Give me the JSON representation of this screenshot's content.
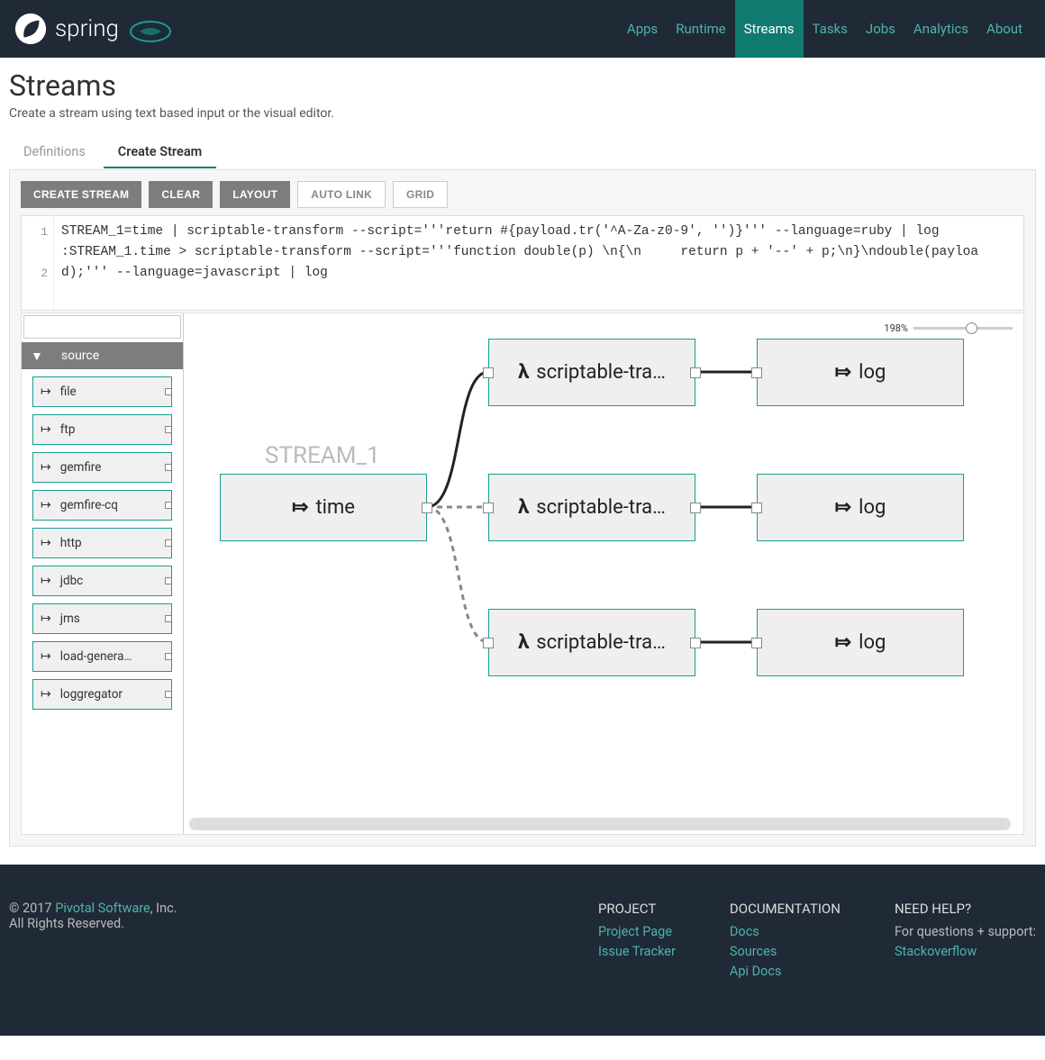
{
  "brand": "spring",
  "nav": [
    {
      "label": "Apps",
      "active": false
    },
    {
      "label": "Runtime",
      "active": false
    },
    {
      "label": "Streams",
      "active": true
    },
    {
      "label": "Tasks",
      "active": false
    },
    {
      "label": "Jobs",
      "active": false
    },
    {
      "label": "Analytics",
      "active": false
    },
    {
      "label": "About",
      "active": false
    }
  ],
  "page": {
    "title": "Streams",
    "subtitle": "Create a stream using text based input or the visual editor."
  },
  "tabs": [
    {
      "label": "Definitions",
      "active": false
    },
    {
      "label": "Create Stream",
      "active": true
    }
  ],
  "buttons": {
    "create": "Create Stream",
    "clear": "Clear",
    "layout": "Layout",
    "autolink": "Auto Link",
    "grid": "Grid"
  },
  "code": {
    "lines": [
      "1",
      "",
      "2",
      ""
    ],
    "text": "STREAM_1=time | scriptable-transform --script='''return #{payload.tr('^A-Za-z0-9', '')}''' --language=ruby | log\n:STREAM_1.time > scriptable-transform --script='''function double(p) \\n{\\n     return p + '--' + p;\\n}\\ndouble(payload);''' --language=javascript | log"
  },
  "palette": {
    "header": "source",
    "items": [
      "file",
      "ftp",
      "gemfire",
      "gemfire-cq",
      "http",
      "jdbc",
      "jms",
      "load-genera…",
      "loggregator"
    ]
  },
  "zoom": "198%",
  "stream_label": "STREAM_1",
  "nodes": {
    "time": "time",
    "script1": "scriptable-tra…",
    "log1": "log",
    "script2": "scriptable-tra…",
    "log2": "log",
    "script3": "scriptable-tra…",
    "log3": "log"
  },
  "footer": {
    "copyright_pre": "© 2017 ",
    "copyright_link": "Pivotal Software",
    "copyright_post": ", Inc.",
    "rights": "All Rights Reserved.",
    "project": {
      "title": "PROJECT",
      "links": [
        "Project Page",
        "Issue Tracker"
      ]
    },
    "docs": {
      "title": "DOCUMENTATION",
      "links": [
        "Docs",
        "Sources",
        "Api Docs"
      ]
    },
    "help": {
      "title": "NEED HELP?",
      "tag": "For questions + support:",
      "links": [
        "Stackoverflow"
      ]
    }
  }
}
